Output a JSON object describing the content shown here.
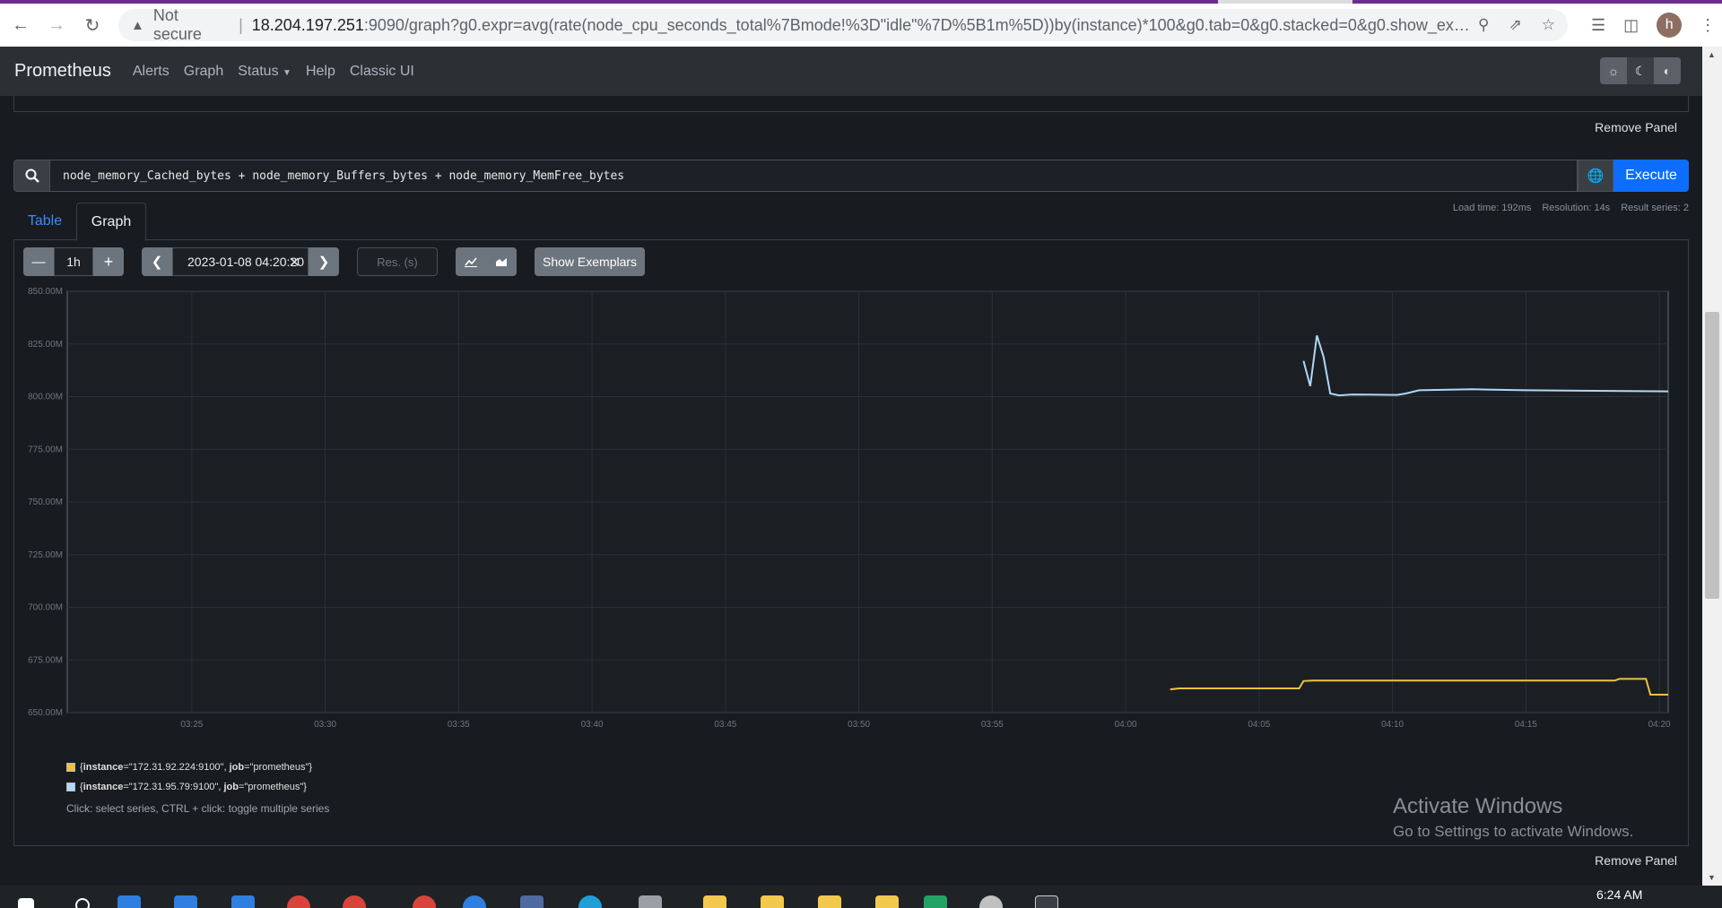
{
  "browser": {
    "security_label": "Not secure",
    "url_host": "18.204.197.251",
    "url_rest": ":9090/graph?g0.expr=avg(rate(node_cpu_seconds_total%7Bmode!%3D\"idle\"%7D%5B1m%5D))by(instance)*100&g0.tab=0&g0.stacked=0&g0.show_exempl...",
    "profile_initial": "h"
  },
  "navbar": {
    "brand": "Prometheus",
    "links": [
      "Alerts",
      "Graph",
      "Status",
      "Help",
      "Classic UI"
    ]
  },
  "panel_prev": {
    "remove_label": "Remove Panel"
  },
  "panel": {
    "expression": "node_memory_Cached_bytes + node_memory_Buffers_bytes + node_memory_MemFree_bytes",
    "execute_label": "Execute",
    "stats": {
      "load_time": "Load time: 192ms",
      "resolution": "Resolution: 14s",
      "result_series": "Result series: 2"
    },
    "tabs": [
      "Table",
      "Graph"
    ],
    "active_tab": "Graph",
    "range": "1h",
    "end_time": "2023-01-08 04:20:20",
    "res_placeholder": "Res. (s)",
    "exemplars_label": "Show Exemplars",
    "legend_hint": "Click: select series, CTRL + click: toggle multiple series",
    "remove_label": "Remove Panel"
  },
  "chart_data": {
    "type": "line",
    "title": "",
    "xlabel": "",
    "ylabel": "",
    "x_ticks": [
      "03:25",
      "03:30",
      "03:35",
      "03:40",
      "03:45",
      "03:50",
      "03:55",
      "04:00",
      "04:05",
      "04:10",
      "04:15",
      "04:20"
    ],
    "y_ticks": [
      "650.00M",
      "675.00M",
      "700.00M",
      "725.00M",
      "750.00M",
      "775.00M",
      "800.00M",
      "825.00M",
      "850.00M"
    ],
    "xlim": [
      "03:20:20",
      "04:20:20"
    ],
    "ylim": [
      650,
      850
    ],
    "y_unit": "M",
    "grid": true,
    "legend_position": "bottom-left",
    "series": [
      {
        "label_instance": "172.31.92.224:9100",
        "label_job": "prometheus",
        "color": "#edc240",
        "points": [
          [
            "04:01:40",
            661
          ],
          [
            "04:02:00",
            661.5
          ],
          [
            "04:06:30",
            661.5
          ],
          [
            "04:06:40",
            665
          ],
          [
            "04:07:00",
            665.2
          ],
          [
            "04:18:20",
            665.2
          ],
          [
            "04:18:30",
            666
          ],
          [
            "04:19:30",
            666
          ],
          [
            "04:19:40",
            658.5
          ],
          [
            "04:20:20",
            658.5
          ]
        ]
      },
      {
        "label_instance": "172.31.95.79:9100",
        "label_job": "prometheus",
        "color": "#afd8f8",
        "points": [
          [
            "04:06:40",
            817
          ],
          [
            "04:06:55",
            805
          ],
          [
            "04:07:10",
            829
          ],
          [
            "04:07:25",
            819
          ],
          [
            "04:07:40",
            801.5
          ],
          [
            "04:08:00",
            800.6
          ],
          [
            "04:08:30",
            801
          ],
          [
            "04:10:10",
            800.8
          ],
          [
            "04:10:30",
            801.5
          ],
          [
            "04:11:00",
            803
          ],
          [
            "04:13:00",
            803.5
          ],
          [
            "04:15:00",
            803
          ],
          [
            "04:17:00",
            802.8
          ],
          [
            "04:20:20",
            802.5
          ]
        ]
      }
    ]
  },
  "watermark": {
    "line1": "Activate Windows",
    "line2": "Go to Settings to activate Windows."
  },
  "taskbar": {
    "clock": "6:24 AM"
  }
}
